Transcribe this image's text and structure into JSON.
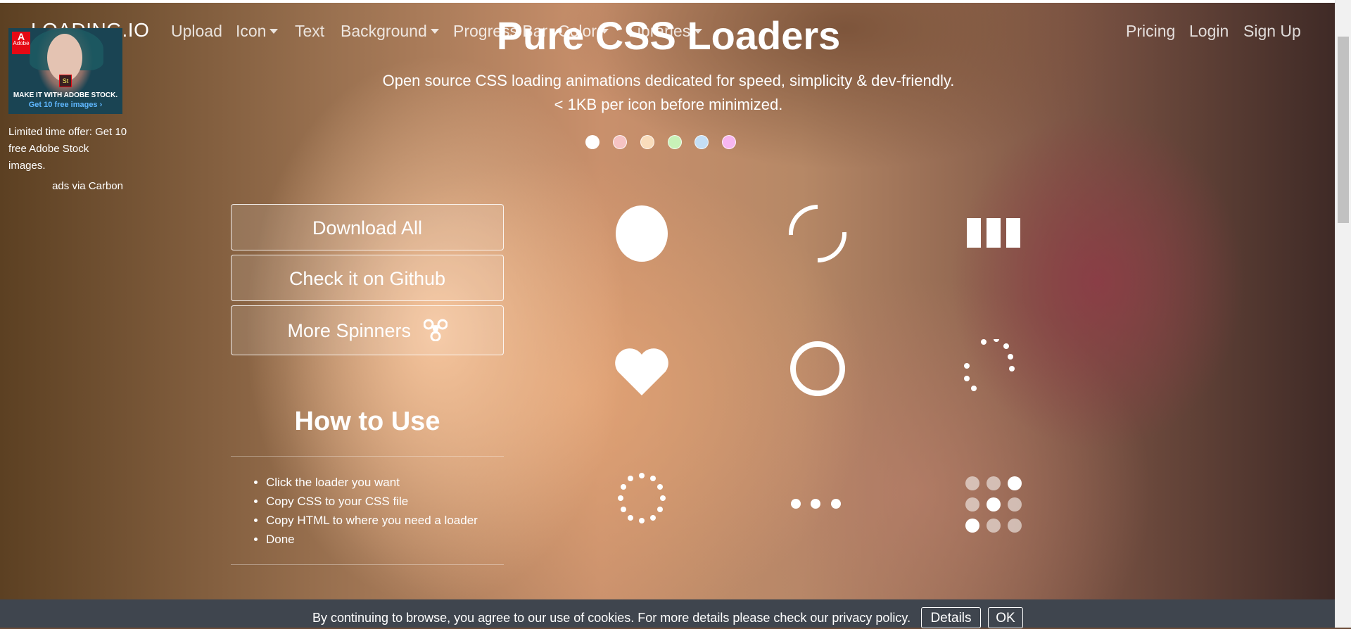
{
  "navbar": {
    "brand": "LOADING.IO",
    "items": [
      {
        "label": "Upload",
        "dropdown": false
      },
      {
        "label": "Icon",
        "dropdown": true
      },
      {
        "label": "Text",
        "dropdown": false
      },
      {
        "label": "Background",
        "dropdown": true
      },
      {
        "label": "Progress Bar",
        "dropdown": false
      },
      {
        "label": "Color",
        "dropdown": true
      },
      {
        "label": "Libraries",
        "dropdown": true
      }
    ],
    "right_items": [
      "Pricing",
      "Login",
      "Sign Up"
    ]
  },
  "ad": {
    "image_logo": "Adobe",
    "image_badge": "St",
    "image_caption": "MAKE IT WITH ADOBE STOCK.",
    "image_cta": "Get 10 free images ›",
    "text": "Limited time offer: Get 10 free Adobe Stock images.",
    "via": "ads via Carbon"
  },
  "hero": {
    "title": "Pure CSS Loaders",
    "subtitle_line1": "Open source CSS loading animations dedicated for speed, simplicity & dev-friendly.",
    "subtitle_line2": "< 1KB per icon before minimized.",
    "color_dots": [
      "#ffffff",
      "#f6c3c3",
      "#f9dcbb",
      "#c8f2b8",
      "#c4def5",
      "#f7b6f0"
    ]
  },
  "buttons": {
    "download_all": "Download All",
    "github": "Check it on Github",
    "more_spinners": "More Spinners"
  },
  "howto": {
    "title": "How to Use",
    "steps": [
      "Click the loader you want",
      "Copy CSS to your CSS file",
      "Copy HTML to where you need a loader",
      "Done"
    ]
  },
  "loaders": [
    "circle",
    "dual-ring",
    "facebook",
    "heart",
    "ring",
    "roller",
    "default",
    "ellipsis",
    "grid"
  ],
  "cookie": {
    "text": "By continuing to browse, you agree to our use of cookies. For more details please check our privacy policy.",
    "details": "Details",
    "ok": "OK"
  }
}
